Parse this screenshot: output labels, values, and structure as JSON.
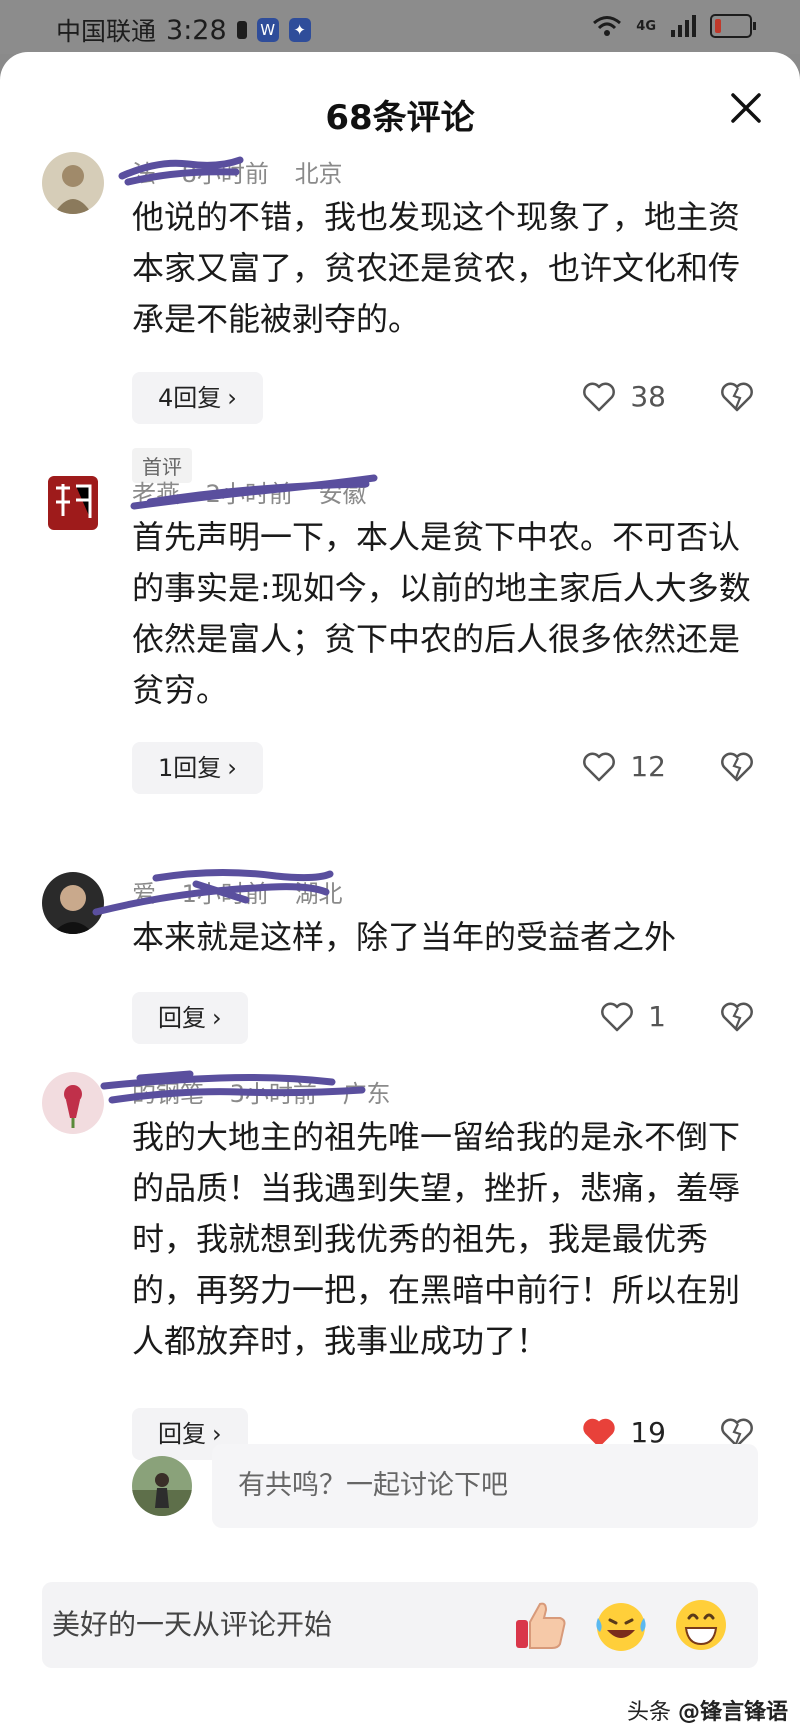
{
  "status_bar": {
    "carrier": "中国联通",
    "time": "3:28",
    "network": "4G"
  },
  "sheet": {
    "title": "68条评论",
    "close_icon": "close-icon"
  },
  "comments": [
    {
      "username": "法",
      "time_ago": "8小时前",
      "location": "北京",
      "text": "他说的不错，我也发现这个现象了，地主资本家又富了，贫农还是贫农，也许文化和传承是不能被剥夺的。",
      "reply_label": "4回复",
      "likes": "38",
      "tag": "首评"
    },
    {
      "username": "老燕",
      "time_ago": "2小时前",
      "location": "安徽",
      "text": "首先声明一下，本人是贫下中农。不可否认的事实是:现如今，以前的地主家后人大多数依然是富人；贫下中农的后人很多依然还是贫穷。",
      "reply_label": "1回复",
      "likes": "12"
    },
    {
      "username": "爱",
      "time_ago": "1小时前",
      "location": "湖北",
      "text": "本来就是这样，除了当年的受益者之外",
      "reply_label": "回复",
      "likes": "1"
    },
    {
      "username": "的钢笔",
      "time_ago": "3小时前",
      "location": "广东",
      "text": "我的大地主的祖先唯一留给我的是永不倒下的品质！当我遇到失望，挫折，悲痛，羞辱时，我就想到我优秀的祖先，我是最优秀的，再努力一把，在黑暗中前行！所以在别人都放弃时，我事业成功了！",
      "reply_label": "回复",
      "likes": "19",
      "liked": true
    }
  ],
  "reply_input": {
    "placeholder": "有共鸣？一起讨论下吧"
  },
  "bottom_bar": {
    "placeholder": "美好的一天从评论开始"
  },
  "watermark": {
    "prefix": "头条",
    "author": "@锋言锋语"
  },
  "colors": {
    "like_red": "#e8413a",
    "scribble": "#5a4f9e"
  }
}
